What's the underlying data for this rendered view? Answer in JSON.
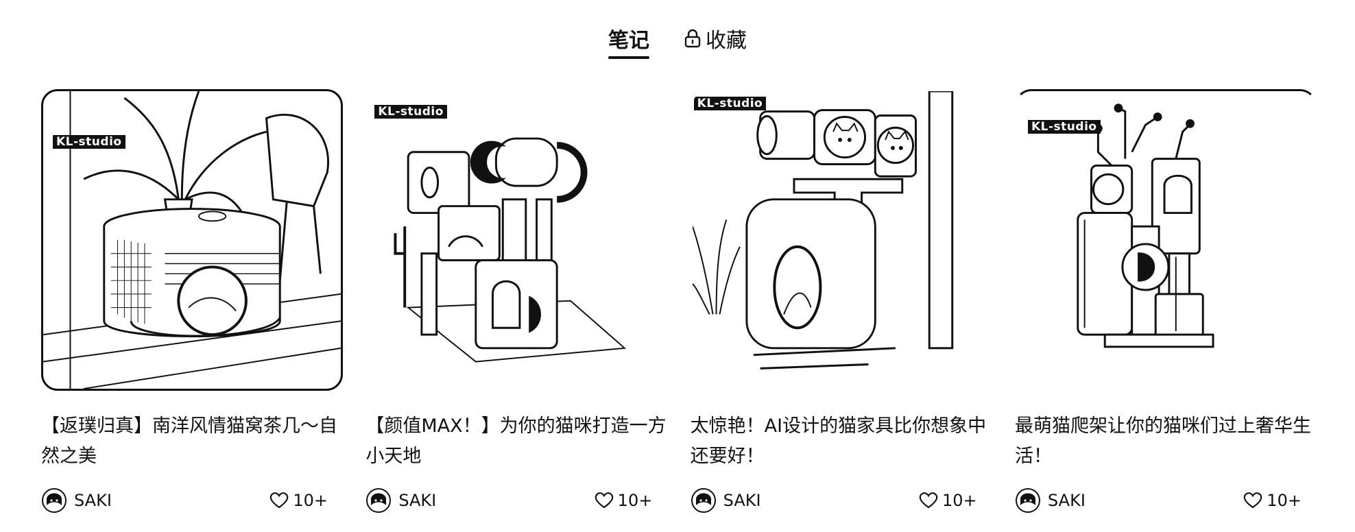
{
  "tabs": [
    {
      "label": "笔记",
      "active": true
    },
    {
      "label": "收藏",
      "active": false,
      "icon": "lock-icon"
    }
  ],
  "notes": [
    {
      "title": "【返璞归真】南洋风情猫窝茶几～自然之美",
      "brand_tag": "KL-studio",
      "image_subject": "rattan cat bed side table",
      "author": "SAKI",
      "likes": "10+"
    },
    {
      "title": "【颜值MAX！】为你的猫咪打造一方小天地",
      "brand_tag": "KL-studio",
      "image_subject": "white cat tree with cubbies",
      "author": "SAKI",
      "likes": "10+"
    },
    {
      "title": "太惊艳！AI设计的猫家具比你想象中还要好！",
      "brand_tag": "KL-studio",
      "image_subject": "white tower cat furniture with cats",
      "author": "SAKI",
      "likes": "10+"
    },
    {
      "title": "最萌猫爬架让你的猫咪们过上奢华生活！",
      "brand_tag": "KL-studio",
      "image_subject": "tall cat climbing frame",
      "author": "SAKI",
      "likes": "10+"
    }
  ],
  "colors": {
    "text": "#111111",
    "background": "#ffffff",
    "tag_bg": "#111111",
    "tag_text": "#ffffff"
  }
}
